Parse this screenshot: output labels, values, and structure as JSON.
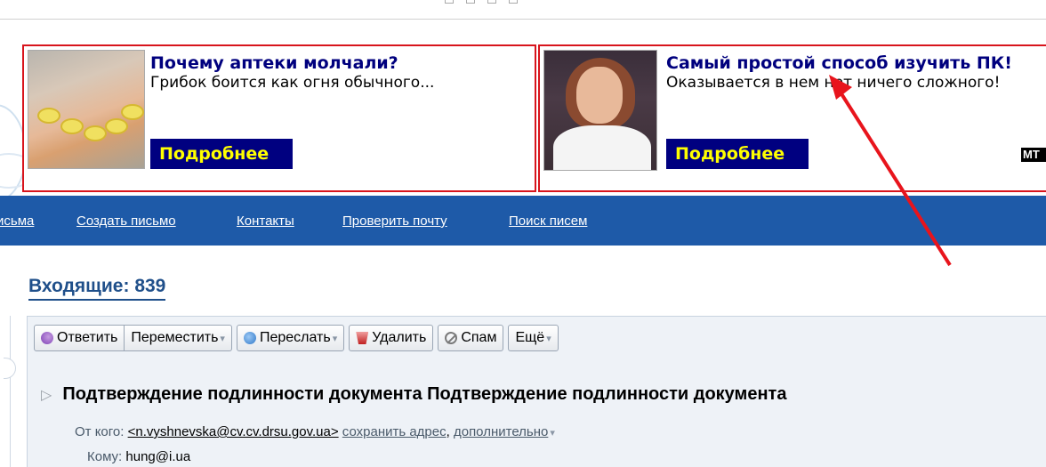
{
  "ads": [
    {
      "headline": "Почему аптеки молчали?",
      "desc": "Грибок боится как огня обычного...",
      "more": "Подробнее"
    },
    {
      "headline": "Самый простой способ изучить ПК!",
      "desc": "Оказывается в нем нет ничего сложного!",
      "more": "Подробнее"
    }
  ],
  "ad_badge": "MT",
  "nav": {
    "items": [
      "исьма",
      "Создать письмо",
      "Контакты",
      "Проверить почту",
      "Поиск писем"
    ]
  },
  "inbox": {
    "title": "Входящие: 839"
  },
  "toolbar": {
    "reply": "Ответить",
    "move": "Переместить",
    "forward": "Переслать",
    "delete": "Удалить",
    "spam": "Спам",
    "more": "Ещё"
  },
  "message": {
    "subject": "Подтверждение подлинности документа Подтверждение подлинности документа",
    "from_label": "От кого:",
    "from_email": "<n.vyshnevska@cv.cv.drsu.gov.ua>",
    "save_address": "сохранить адрес",
    "more_link": "дополнительно",
    "to_label": "Кому:",
    "to_value": "hung@i.ua"
  },
  "colors": {
    "nav_bg": "#1e5aa8",
    "ad_border": "#d8141c",
    "ad_button_bg": "#000080",
    "ad_button_text": "#ffff00",
    "arrow": "#e8141c"
  }
}
